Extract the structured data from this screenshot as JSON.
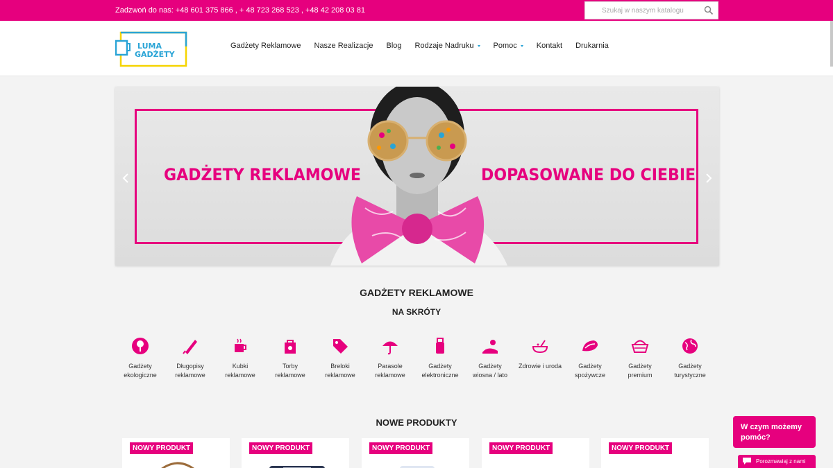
{
  "topbar": {
    "phone": "Zadzwoń do nas: +48 601 375 866 , + 48 723 268 523 , +48 42 208 03 81",
    "search_placeholder": "Szukaj w naszym katalogu"
  },
  "logo": {
    "line1": "LUMA",
    "line2": "GADŻETY"
  },
  "nav": [
    {
      "label": "Gadżety Reklamowe",
      "dropdown": false
    },
    {
      "label": "Nasze Realizacje",
      "dropdown": false
    },
    {
      "label": "Blog",
      "dropdown": false
    },
    {
      "label": "Rodzaje Nadruku",
      "dropdown": true
    },
    {
      "label": "Pomoc",
      "dropdown": true
    },
    {
      "label": "Kontakt",
      "dropdown": false
    },
    {
      "label": "Drukarnia",
      "dropdown": false
    }
  ],
  "banner": {
    "left_text": "GADŻETY REKLAMOWE",
    "right_text": "DOPASOWANE DO CIEBIE"
  },
  "sections": {
    "main_title": "GADŻETY REKLAMOWE",
    "shortcuts_title": "NA SKRÓTY",
    "new_products_title": "NOWE PRODUKTY"
  },
  "categories": [
    {
      "line1": "Gadżety",
      "line2": "ekologiczne",
      "icon": "tree-icon"
    },
    {
      "line1": "Długopisy",
      "line2": "reklamowe",
      "icon": "pen-icon"
    },
    {
      "line1": "Kubki",
      "line2": "reklamowe",
      "icon": "mug-icon"
    },
    {
      "line1": "Torby",
      "line2": "reklamowe",
      "icon": "bag-icon"
    },
    {
      "line1": "Breloki",
      "line2": "reklamowe",
      "icon": "tag-icon"
    },
    {
      "line1": "Parasole",
      "line2": "reklamowe",
      "icon": "umbrella-icon"
    },
    {
      "line1": "Gadżety",
      "line2": "elektroniczne",
      "icon": "usb-icon"
    },
    {
      "line1": "Gadżety",
      "line2": "wiosna / lato",
      "icon": "sun-icon"
    },
    {
      "line1": "Zdrowie i uroda",
      "line2": "",
      "icon": "bowl-icon"
    },
    {
      "line1": "Gadżety",
      "line2": "spożywcze",
      "icon": "food-icon"
    },
    {
      "line1": "Gadżety",
      "line2": "premium",
      "icon": "basket-icon"
    },
    {
      "line1": "Gadżety",
      "line2": "turystyczne",
      "icon": "globe-icon"
    }
  ],
  "products": [
    {
      "badge": "NOWY PRODUKT"
    },
    {
      "badge": "NOWY PRODUKT"
    },
    {
      "badge": "NOWY PRODUKT"
    },
    {
      "badge": "NOWY PRODUKT"
    },
    {
      "badge": "NOWY PRODUKT"
    }
  ],
  "chat": {
    "bubble": "W czym możemy pomóc?",
    "button": "Porozmawiaj z nami"
  },
  "colors": {
    "brand": "#e6007e",
    "accent_blue": "#2aa4d6",
    "logo_yellow": "#f5d400"
  }
}
